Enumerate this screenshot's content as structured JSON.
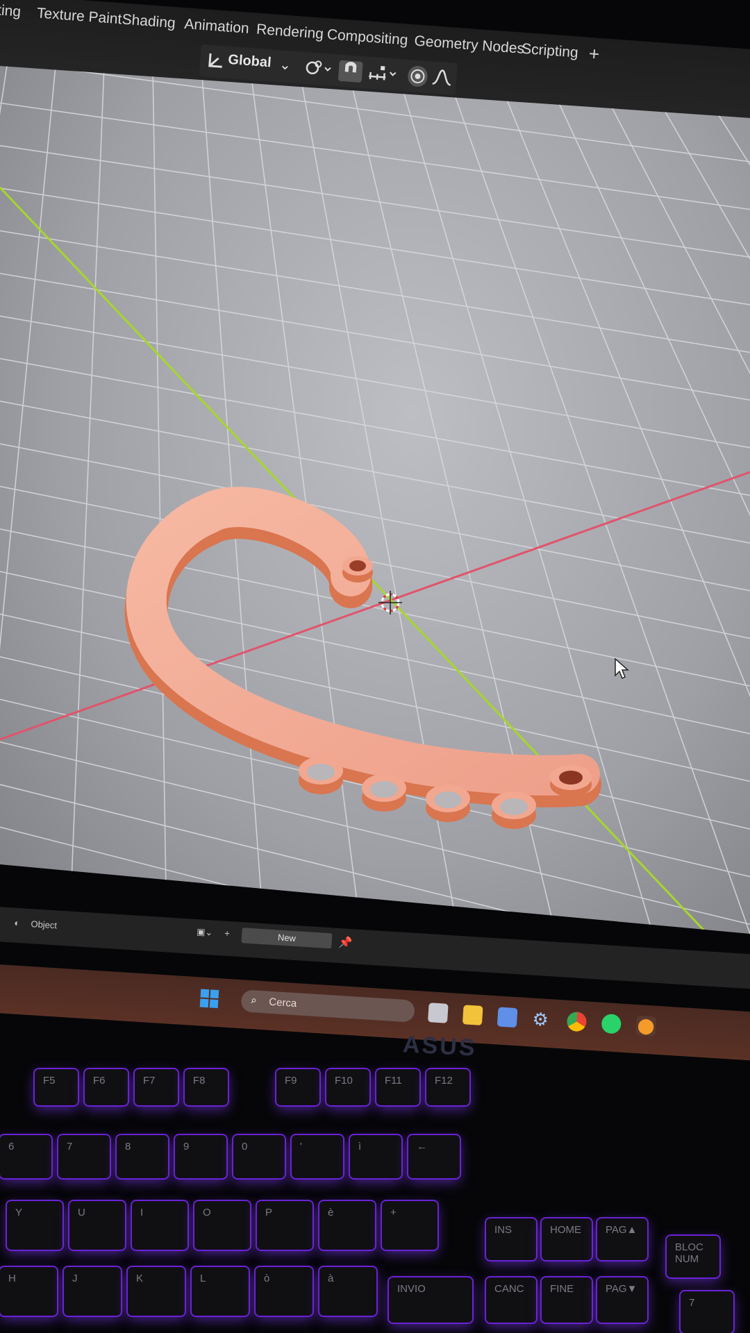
{
  "workspace_tabs": [
    "ting",
    "Texture Paint",
    "Shading",
    "Animation",
    "Rendering",
    "Compositing",
    "Geometry Nodes",
    "Scripting",
    "+"
  ],
  "header": {
    "transform_orientation": "Global"
  },
  "status_bar": {
    "mode_label": "Object",
    "new_label": "New"
  },
  "taskbar": {
    "search_placeholder": "Cerca",
    "laptop_brand": "ASUS",
    "icons": [
      "windows-start-icon",
      "search-icon",
      "task-view-icon",
      "file-explorer-icon",
      "store-icon",
      "settings-icon",
      "chrome-icon",
      "whatsapp-icon",
      "blender-icon"
    ]
  },
  "keyboard": {
    "function_row": [
      "F5",
      "F6",
      "F7",
      "F8",
      "F9",
      "F10",
      "F11",
      "F12"
    ],
    "number_row": [
      "6",
      "7",
      "8",
      "9",
      "0",
      "'",
      "ì",
      "←"
    ],
    "top_letter_row": [
      "Y",
      "U",
      "I",
      "O",
      "P",
      "è",
      "+"
    ],
    "home_row": [
      "H",
      "J",
      "K",
      "L",
      "ò",
      "à"
    ],
    "nav_keys": [
      "INS",
      "HOME",
      "PAG▲",
      "CANC",
      "FINE",
      "PAG▼",
      "INVIO"
    ],
    "numpad": [
      "BLOC NUM",
      "7"
    ]
  },
  "colors": {
    "x_axis": "#e0546b",
    "y_axis": "#a7d62c",
    "mesh": "#f0a088",
    "viewport_bg": "#a9aaae",
    "key_backlight": "#7a2cff"
  }
}
